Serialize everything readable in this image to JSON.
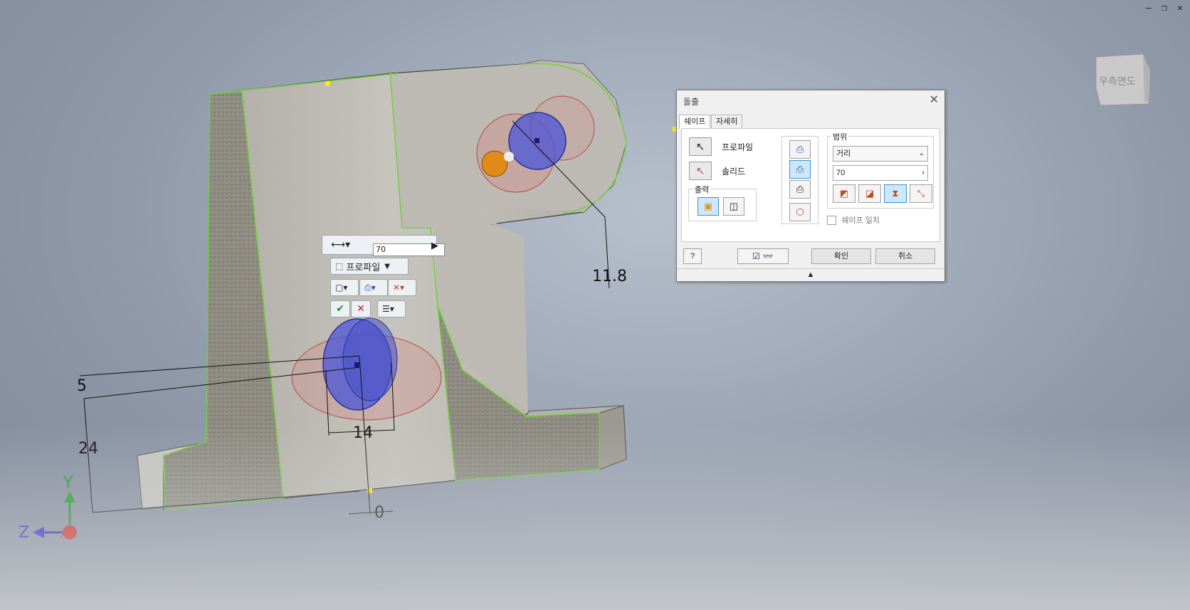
{
  "window_controls": {
    "minimize": "–",
    "restore": "❐",
    "close": "✕"
  },
  "viewcube": {
    "label": "우측면도"
  },
  "dimensions": {
    "d_top_right": "11.8",
    "d_5": "5",
    "d_24": "24",
    "d_14": "14",
    "d_0": "0"
  },
  "axes": {
    "y": "Y",
    "z": "Z",
    "x": "X"
  },
  "minitoolbar": {
    "distance_value": "70",
    "profile_label": "프로파일"
  },
  "dialog": {
    "title": "돌출",
    "close": "✕",
    "tabs": [
      "쉐이프",
      "자세히"
    ],
    "profile_label": "프로파일",
    "solid_label": "솔리드",
    "output_label": "출력",
    "extent_label": "범위",
    "extent_type": "거리",
    "distance_value": "70",
    "match_shape_label": "쉐이프 일치",
    "ok_label": "확인",
    "cancel_label": "취소",
    "expand_arrow": "▲"
  },
  "colors": {
    "accent_blue": "#3c8fd9",
    "model_gray": "#b8b7b0",
    "edge_green": "#6fd13d",
    "preview_blue": "#4a55d8",
    "preview_red": "#d88080"
  }
}
